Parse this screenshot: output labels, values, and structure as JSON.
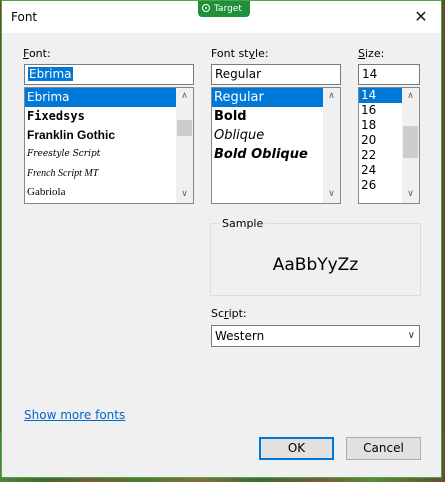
{
  "window": {
    "title": "Font",
    "close_glyph": "✕"
  },
  "badge": {
    "label": "Target"
  },
  "font": {
    "label_prefix": "F",
    "label_rest": "ont:",
    "value": "Ebrima",
    "items": [
      "Ebrima",
      "Fixedsys",
      "Franklin Gothic",
      "Freestyle Script",
      "French Script MT",
      "Gabriola"
    ]
  },
  "style": {
    "label_prefix": "Font st",
    "label_under": "y",
    "label_rest": "le:",
    "value": "Regular",
    "items": [
      "Regular",
      "Bold",
      "Oblique",
      "Bold Oblique"
    ]
  },
  "size": {
    "label_prefix": "S",
    "label_rest": "ize:",
    "value": "14",
    "items": [
      "14",
      "16",
      "18",
      "20",
      "22",
      "24",
      "26"
    ]
  },
  "sample": {
    "label": "Sample",
    "text": "AaBbYyZz"
  },
  "script": {
    "label_prefix": "Sc",
    "label_under": "r",
    "label_rest": "ipt:",
    "value": "Western"
  },
  "links": {
    "show_more": "Show more fonts"
  },
  "buttons": {
    "ok": "OK",
    "cancel": "Cancel"
  },
  "colors": {
    "selection": "#0078d7",
    "accent": "#1f8f3a",
    "link": "#0066cc"
  }
}
